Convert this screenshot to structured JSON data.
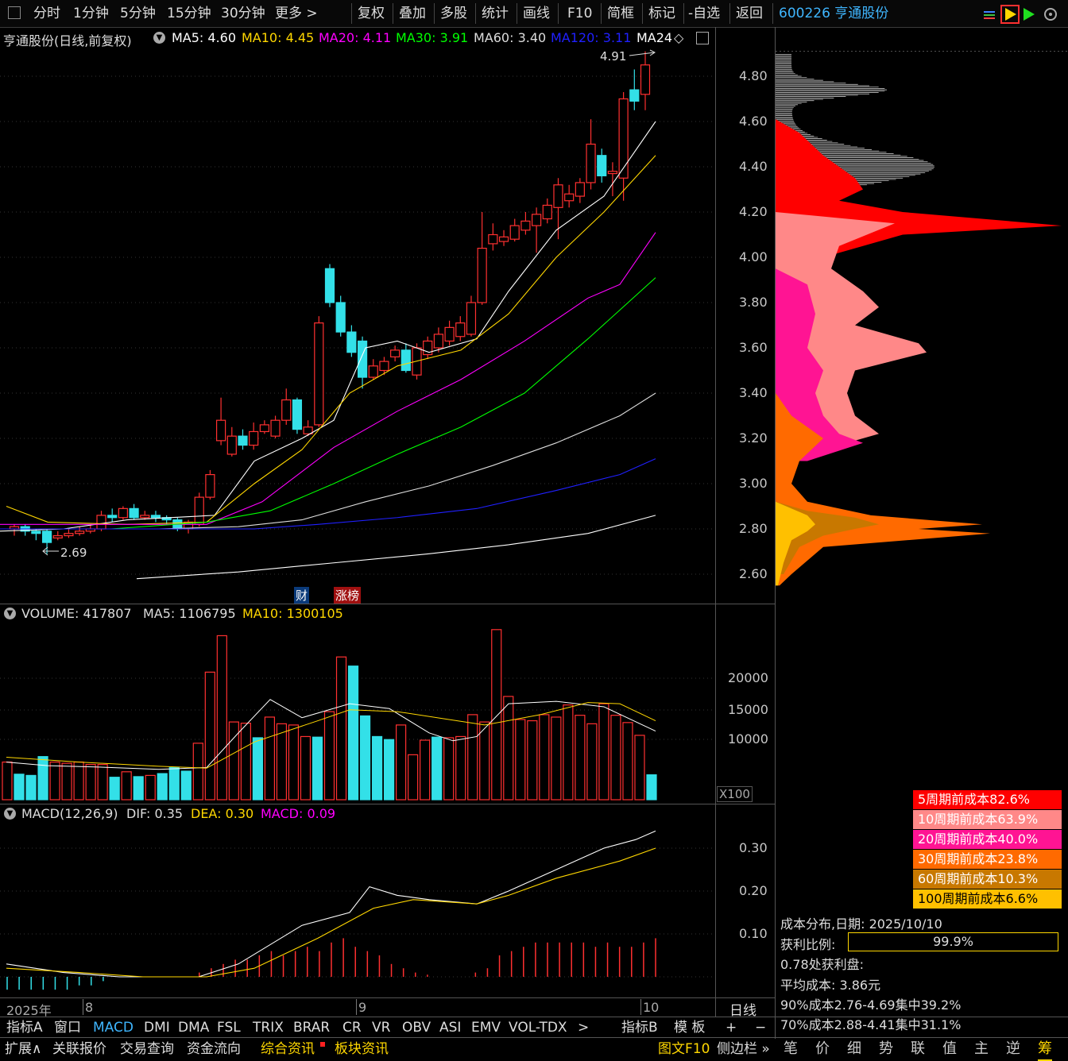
{
  "toolbar": {
    "items": [
      "分时",
      "1分钟",
      "5分钟",
      "15分钟",
      "30分钟",
      "更多 >"
    ],
    "right_items": [
      "复权",
      "叠加",
      "多股",
      "统计",
      "画线",
      "F10",
      "简框",
      "标记",
      "-自选",
      "返回"
    ],
    "stock_header": "600226 亨通股份"
  },
  "chart_header": {
    "title": "亨通股份(日线,前复权)",
    "ma": [
      {
        "label": "MA5: 4.60",
        "color": "#ffffff"
      },
      {
        "label": "MA10: 4.45",
        "color": "#ffd700"
      },
      {
        "label": "MA20: 4.11",
        "color": "#ff00ff"
      },
      {
        "label": "MA30: 3.91",
        "color": "#00ff00"
      },
      {
        "label": "MA60: 3.40",
        "color": "#dddddd"
      },
      {
        "label": "MA120: 3.11",
        "color": "#2020ff"
      },
      {
        "label": "MA24",
        "color": "#ffffff"
      }
    ]
  },
  "price_axis": [
    "4.80",
    "4.60",
    "4.40",
    "4.20",
    "4.00",
    "3.80",
    "3.60",
    "3.40",
    "3.20",
    "3.00",
    "2.80",
    "2.60"
  ],
  "price_annotations": {
    "high": "4.91",
    "low": "2.69"
  },
  "event_tags": {
    "cai": "财",
    "zhangbang": "涨榜"
  },
  "volume_header": {
    "name": "VOLUME: 417807",
    "ma5": "MA5: 1106795",
    "ma10": "MA10: 1300105"
  },
  "volume_axis": [
    "20000",
    "15000",
    "10000"
  ],
  "volume_unit": "X100",
  "macd_header": {
    "name": "MACD(12,26,9)",
    "dif": "DIF: 0.35",
    "dea": "DEA: 0.30",
    "macd": "MACD: 0.09"
  },
  "macd_axis": [
    "0.30",
    "0.20",
    "0.10"
  ],
  "date_axis": {
    "year": "2025年",
    "m8": "8",
    "m9": "9",
    "m10": "10",
    "period": "日线"
  },
  "indicator_tabs": [
    "指标A",
    "窗口",
    "MACD",
    "DMI",
    "DMA",
    "FSL",
    "TRIX",
    "BRAR",
    "CR",
    "VR",
    "OBV",
    "ASI",
    "EMV",
    "VOL-TDX",
    ">",
    "指标B",
    "模 板",
    "+",
    "−"
  ],
  "bottom_buttons": [
    "扩展∧",
    "关联报价",
    "交易查询",
    "资金流向",
    "综合资讯",
    "板块资讯",
    "图文F10",
    "侧边栏 »"
  ],
  "right_icons": [
    "笔",
    "价",
    "细",
    "势",
    "联",
    "值",
    "主",
    "逆",
    "筹"
  ],
  "cost_legend": [
    {
      "label": "5周期前成本82.6%",
      "bg": "#ff0000",
      "fg": "#ffffff"
    },
    {
      "label": "10周期前成本63.9%",
      "bg": "#ff8888",
      "fg": "#ffffff"
    },
    {
      "label": "20周期前成本40.0%",
      "bg": "#ff1493",
      "fg": "#ffffff"
    },
    {
      "label": "30周期前成本23.8%",
      "bg": "#ff6a00",
      "fg": "#ffffff"
    },
    {
      "label": "60周期前成本10.3%",
      "bg": "#c87800",
      "fg": "#ffffff"
    },
    {
      "label": "100周期前成本6.6%",
      "bg": "#ffc000",
      "fg": "#000000"
    }
  ],
  "cost_info": {
    "date_line": "成本分布,日期: 2025/10/10",
    "profit_label": "获利比例:",
    "profit_value": "99.9%",
    "profit_at": "0.78处获利盘:",
    "avg_cost": "平均成本: 3.86元",
    "c90": "90%成本2.76-4.69集中39.2%",
    "c70": "70%成本2.88-4.41集中31.1%"
  }
}
